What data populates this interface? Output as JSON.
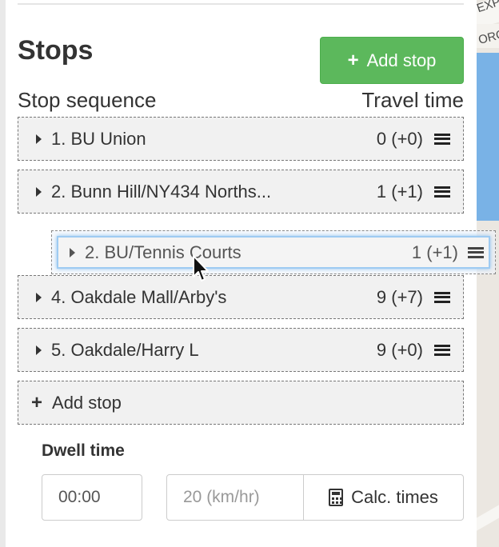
{
  "map": {
    "label_1": "EXP",
    "label_2": "ORG"
  },
  "stops_panel": {
    "title": "Stops",
    "add_stop_button": "Add stop",
    "columns": {
      "sequence": "Stop sequence",
      "travel_time": "Travel time"
    },
    "stops": [
      {
        "name": "1. BU Union",
        "time": "0 (+0)"
      },
      {
        "name": "2. Bunn Hill/NY434 Norths...",
        "time": "1 (+1)"
      },
      {
        "name": "4. Oakdale Mall/Arby's",
        "time": "9 (+7)"
      },
      {
        "name": "5. Oakdale/Harry L",
        "time": "9 (+0)"
      }
    ],
    "dragging_stop": {
      "name": "2. BU/Tennis Courts",
      "time": "1 (+1)"
    },
    "add_stop_row": "Add stop"
  },
  "dwell": {
    "label": "Dwell time",
    "value": "00:00",
    "speed_placeholder": "20 (km/hr)",
    "calc_button": "Calc. times"
  }
}
